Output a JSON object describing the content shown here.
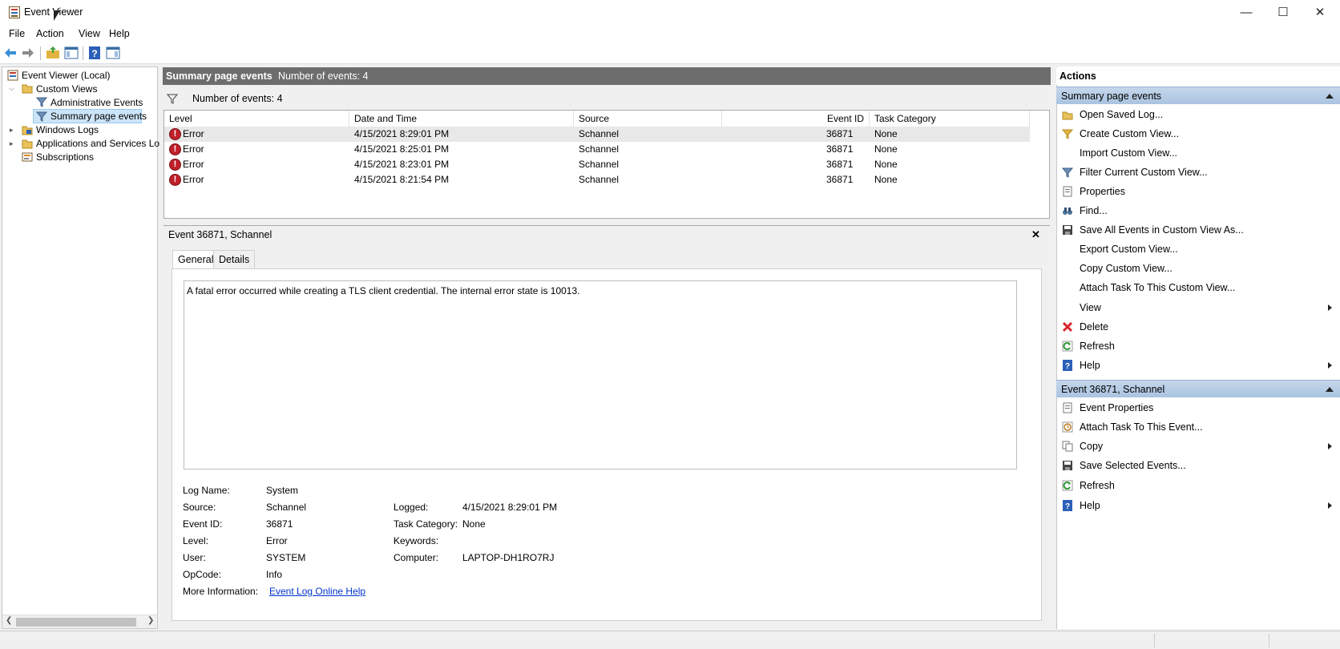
{
  "window": {
    "title": "Event Viewer"
  },
  "menu": [
    "File",
    "Action",
    "View",
    "Help"
  ],
  "tree": {
    "root": "Event Viewer (Local)",
    "custom_views": "Custom Views",
    "admin_events": "Administrative Events",
    "summary_events": "Summary page events",
    "windows_logs": "Windows Logs",
    "apps_services": "Applications and Services Lo",
    "subscriptions": "Subscriptions"
  },
  "center": {
    "header_title": "Summary page events",
    "header_count": "Number of events: 4",
    "filter_count": "Number of events: 4",
    "columns": [
      "Level",
      "Date and Time",
      "Source",
      "Event ID",
      "Task Category"
    ],
    "rows": [
      {
        "level": "Error",
        "datetime": "4/15/2021 8:29:01 PM",
        "source": "Schannel",
        "event_id": "36871",
        "task": "None"
      },
      {
        "level": "Error",
        "datetime": "4/15/2021 8:25:01 PM",
        "source": "Schannel",
        "event_id": "36871",
        "task": "None"
      },
      {
        "level": "Error",
        "datetime": "4/15/2021 8:23:01 PM",
        "source": "Schannel",
        "event_id": "36871",
        "task": "None"
      },
      {
        "level": "Error",
        "datetime": "4/15/2021 8:21:54 PM",
        "source": "Schannel",
        "event_id": "36871",
        "task": "None"
      }
    ]
  },
  "detail": {
    "title": "Event 36871, Schannel",
    "close": "✕",
    "tabs": [
      "General",
      "Details"
    ],
    "description": "A fatal error occurred while creating a TLS client credential. The internal error state is 10013.",
    "labels": {
      "log_name": "Log Name:",
      "source": "Source:",
      "event_id": "Event ID:",
      "level": "Level:",
      "user": "User:",
      "opcode": "OpCode:",
      "more_info": "More Information:",
      "logged": "Logged:",
      "task_category": "Task Category:",
      "keywords": "Keywords:",
      "computer": "Computer:"
    },
    "values": {
      "log_name": "System",
      "source": "Schannel",
      "event_id": "36871",
      "level": "Error",
      "user": "SYSTEM",
      "opcode": "Info",
      "more_info_link": "Event Log Online Help",
      "logged": "4/15/2021 8:29:01 PM",
      "task_category": "None",
      "keywords": "",
      "computer": "LAPTOP-DH1RO7RJ"
    }
  },
  "actions": {
    "title": "Actions",
    "section1": "Summary page events",
    "items1": [
      "Open Saved Log...",
      "Create Custom View...",
      "Import Custom View...",
      "Filter Current Custom View...",
      "Properties",
      "Find...",
      "Save All Events in Custom View As...",
      "Export Custom View...",
      "Copy Custom View...",
      "Attach Task To This Custom View...",
      "View",
      "Delete",
      "Refresh",
      "Help"
    ],
    "section2": "Event 36871, Schannel",
    "items2": [
      "Event Properties",
      "Attach Task To This Event...",
      "Copy",
      "Save Selected Events...",
      "Refresh",
      "Help"
    ]
  },
  "colors": {
    "error_red": "#c0202a",
    "section_blue": "#b7cde6",
    "header_gray": "#6d6d6d",
    "link": "#0033cc",
    "selection": "#cde8ff"
  }
}
